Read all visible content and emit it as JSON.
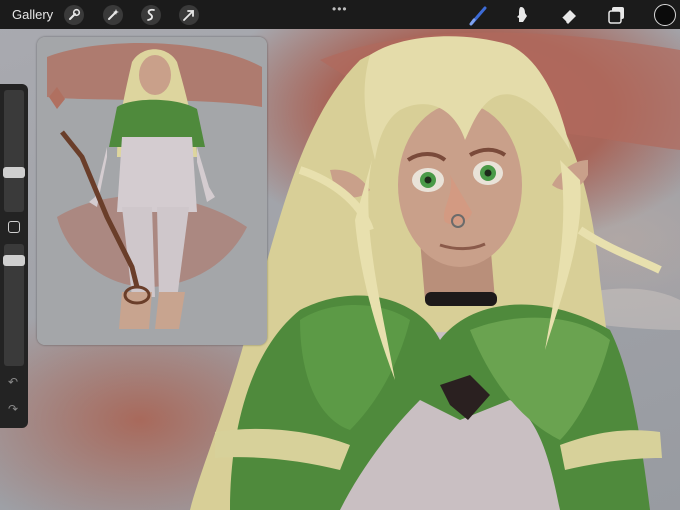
{
  "topbar": {
    "gallery_label": "Gallery",
    "more_label": "•••",
    "left_tools": [
      "wrench-icon",
      "wand-icon",
      "selection-icon",
      "transform-icon"
    ],
    "right_tools": [
      "brush-icon",
      "smudge-icon",
      "eraser-icon",
      "layers-icon"
    ],
    "active_tool": "brush",
    "brush_color": "#3d6bd6",
    "current_color": "#0b0b0b"
  },
  "sidebar": {
    "controls": [
      "size-slider",
      "modify-button",
      "opacity-slider",
      "undo-icon",
      "redo-icon"
    ]
  },
  "colors": {
    "bar": "#1b1b1b",
    "hair": "#e2dba6",
    "cape": "#4f8a3c",
    "skin": "#c9a08a",
    "background_red": "#a8665a",
    "shirt": "#c8bfc4"
  }
}
